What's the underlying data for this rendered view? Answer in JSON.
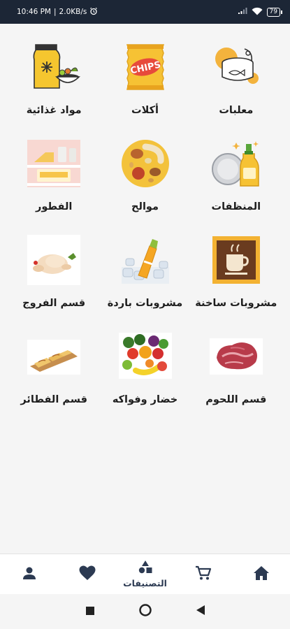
{
  "status_bar": {
    "time": "10:46 PM",
    "speed": "2.0KB/s",
    "battery": "79"
  },
  "categories": [
    {
      "label": "معلبات",
      "icon": "canned-food-icon"
    },
    {
      "label": "أكلات",
      "icon": "chips-bag-icon"
    },
    {
      "label": "مواد غذائية",
      "icon": "groceries-icon"
    },
    {
      "label": "المنظفات",
      "icon": "detergent-icon"
    },
    {
      "label": "موالح",
      "icon": "nuts-icon"
    },
    {
      "label": "الفطور",
      "icon": "breakfast-icon"
    },
    {
      "label": "مشروبات ساخنة",
      "icon": "hot-drink-icon"
    },
    {
      "label": "مشروبات باردة",
      "icon": "cold-drink-icon"
    },
    {
      "label": "قسم الفروج",
      "icon": "chicken-icon"
    },
    {
      "label": "قسم اللحوم",
      "icon": "meat-icon"
    },
    {
      "label": "خضار وفواكه",
      "icon": "fruits-vegetables-icon"
    },
    {
      "label": "قسم الفطائر",
      "icon": "pastries-icon"
    }
  ],
  "chips_text": "CHIPS",
  "bottom_nav": {
    "categories_label": "التصنيفات"
  },
  "colors": {
    "status_bg": "#1c2636",
    "nav_active": "#2c3a52",
    "page_bg": "#f5f5f5"
  }
}
